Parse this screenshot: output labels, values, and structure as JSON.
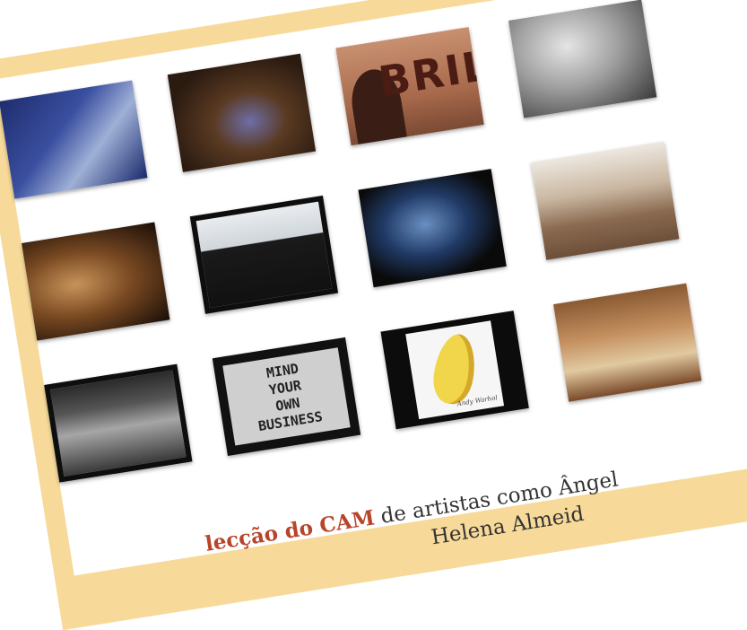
{
  "sign_text": "MIND\nYOUR\nOWN\nBUSINESS",
  "bril_text": "BRIL",
  "banana_signature": "Andy Warhol",
  "caption": {
    "bold": "lecção do CAM",
    "line1_rest": " de artistas como Ângel",
    "line2": "Helena Almeid"
  },
  "colors": {
    "frame": "#f7da9a",
    "accent_text": "#b8452a"
  }
}
